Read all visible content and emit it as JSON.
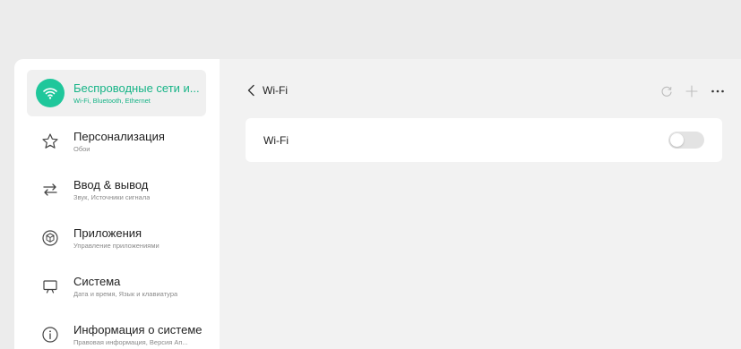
{
  "sidebar": {
    "items": [
      {
        "title": "Беспроводные сети и...",
        "subtitle": "Wi-Fi, Bluetooth, Ethernet",
        "icon": "wifi-icon",
        "active": true
      },
      {
        "title": "Персонализация",
        "subtitle": "Обои",
        "icon": "star-icon"
      },
      {
        "title": "Ввод & вывод",
        "subtitle": "Звук, Источники сигнала",
        "icon": "swap-arrows-icon"
      },
      {
        "title": "Приложения",
        "subtitle": "Управление приложениями",
        "icon": "cube-icon"
      },
      {
        "title": "Система",
        "subtitle": "Дата и время, Язык и клавиатура",
        "icon": "monitor-icon"
      },
      {
        "title": "Информация о системе",
        "subtitle": "Правовая информация, Версия Ап...",
        "icon": "info-icon"
      }
    ]
  },
  "main": {
    "header": {
      "title": "Wi-Fi"
    },
    "actions": [
      "refresh-icon",
      "plus-icon",
      "more-icon"
    ],
    "wifi_row": {
      "label": "Wi-Fi",
      "enabled": false
    }
  },
  "colors": {
    "accent": "#1fc79b",
    "background": "#f2f2f2",
    "card": "#ffffff"
  }
}
